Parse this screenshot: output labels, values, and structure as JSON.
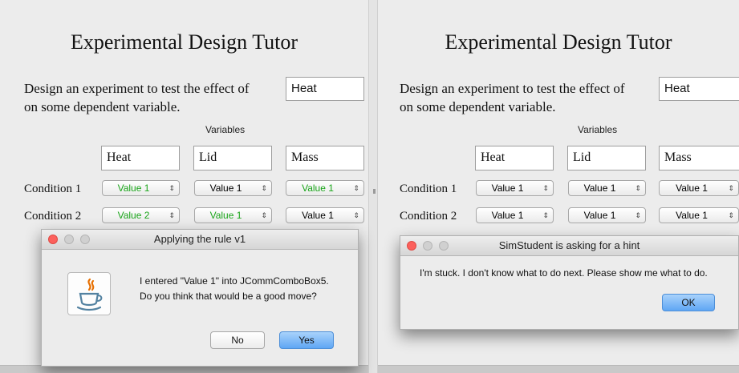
{
  "left": {
    "title": "Experimental Design Tutor",
    "prompt_line1": "Design an experiment to test the effect of",
    "prompt_line2": "on some dependent variable.",
    "effect_field_value": "Heat",
    "variables_label": "Variables",
    "variable_headers": [
      "Heat",
      "Lid",
      "Mass"
    ],
    "conditions": [
      {
        "label": "Condition 1",
        "values": [
          "Value 1",
          "Value 1",
          "Value 1"
        ],
        "green": [
          true,
          false,
          true
        ]
      },
      {
        "label": "Condition 2",
        "values": [
          "Value 2",
          "Value 1",
          "Value 1"
        ],
        "green": [
          true,
          true,
          false
        ]
      }
    ],
    "dialog": {
      "title": "Applying the rule v1",
      "message_line1": "I entered \"Value 1\" into JCommComboBox5.",
      "message_line2": "Do you think that would be a good move?",
      "no_label": "No",
      "yes_label": "Yes",
      "icon": "java-coffee-cup-icon"
    }
  },
  "right": {
    "title": "Experimental Design Tutor",
    "prompt_line1": "Design an experiment to test the effect of",
    "prompt_line2": "on some dependent variable.",
    "effect_field_value": "Heat",
    "variables_label": "Variables",
    "variable_headers": [
      "Heat",
      "Lid",
      "Mass"
    ],
    "conditions": [
      {
        "label": "Condition 1",
        "values": [
          "Value 1",
          "Value 1",
          "Value 1"
        ]
      },
      {
        "label": "Condition 2",
        "values": [
          "Value 1",
          "Value 1",
          "Value 1"
        ]
      }
    ],
    "dialog": {
      "title": "SimStudent is asking for a hint",
      "message": "I'm stuck.  I don't know what to do next.  Please show me what to do.",
      "ok_label": "OK"
    }
  },
  "colors": {
    "value_green": "#1aa51a",
    "default_button_blue": "#5fa6f4",
    "close_button_red": "#fc605c"
  }
}
